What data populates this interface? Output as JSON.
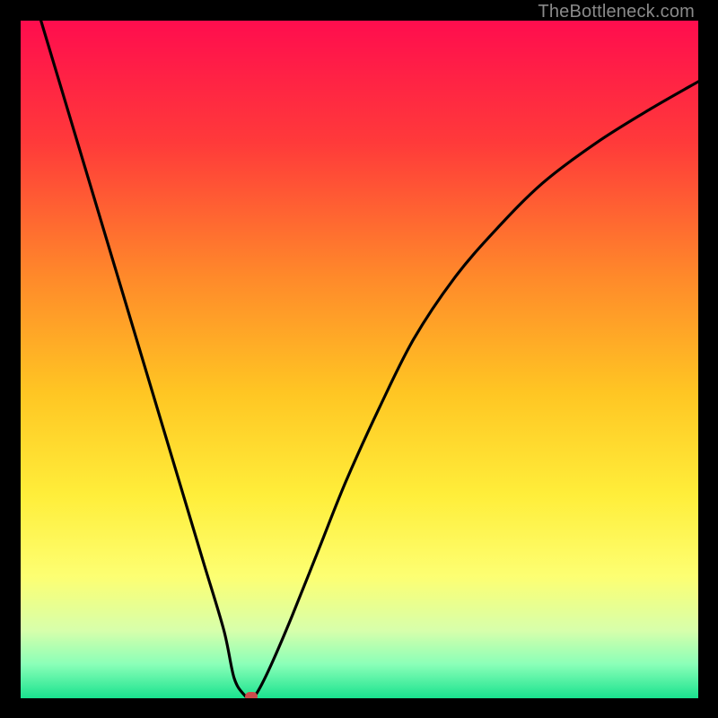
{
  "watermark": "TheBottleneck.com",
  "colors": {
    "frame": "#000000",
    "watermark": "#8a8a8a",
    "curve": "#000000",
    "marker": "#cc4b4b"
  },
  "gradient_stops": [
    {
      "pct": 0,
      "color": "#ff0d4e"
    },
    {
      "pct": 18,
      "color": "#ff3a3a"
    },
    {
      "pct": 38,
      "color": "#ff8a2a"
    },
    {
      "pct": 55,
      "color": "#ffc623"
    },
    {
      "pct": 70,
      "color": "#ffee3a"
    },
    {
      "pct": 82,
      "color": "#fdff72"
    },
    {
      "pct": 90,
      "color": "#d7ffab"
    },
    {
      "pct": 95,
      "color": "#8affb8"
    },
    {
      "pct": 100,
      "color": "#19e28e"
    }
  ],
  "chart_data": {
    "type": "line",
    "title": "",
    "xlabel": "",
    "ylabel": "",
    "xlim": [
      0,
      100
    ],
    "ylim": [
      0,
      100
    ],
    "series": [
      {
        "name": "bottleneck-curve",
        "x": [
          0,
          3,
          6,
          9,
          12,
          15,
          18,
          21,
          24,
          27,
          30,
          31.5,
          33,
          34,
          35,
          37,
          40,
          44,
          48,
          53,
          58,
          64,
          70,
          77,
          85,
          93,
          100
        ],
        "values": [
          110,
          100,
          90,
          80,
          70,
          60,
          50,
          40,
          30,
          20,
          10,
          3,
          0.5,
          0,
          1,
          5,
          12,
          22,
          32,
          43,
          53,
          62,
          69,
          76,
          82,
          87,
          91
        ]
      }
    ],
    "marker": {
      "x": 34,
      "y": 0,
      "name": "optimal-point"
    }
  }
}
